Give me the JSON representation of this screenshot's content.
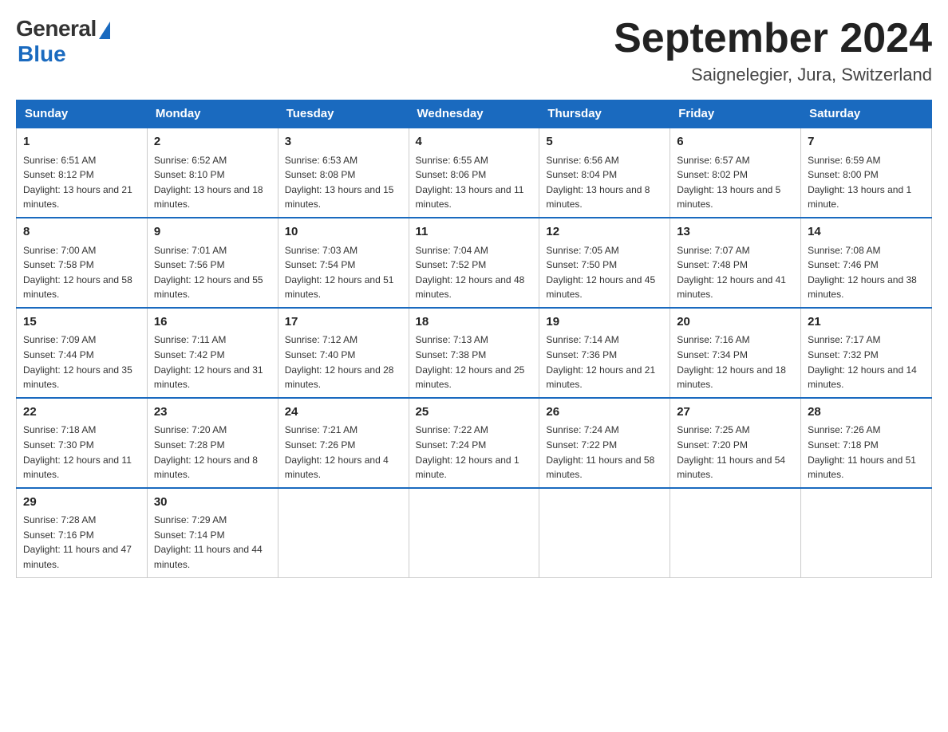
{
  "logo": {
    "general": "General",
    "blue": "Blue"
  },
  "title": "September 2024",
  "subtitle": "Saignelegier, Jura, Switzerland",
  "headers": [
    "Sunday",
    "Monday",
    "Tuesday",
    "Wednesday",
    "Thursday",
    "Friday",
    "Saturday"
  ],
  "weeks": [
    [
      {
        "day": "1",
        "sunrise": "6:51 AM",
        "sunset": "8:12 PM",
        "daylight": "13 hours and 21 minutes."
      },
      {
        "day": "2",
        "sunrise": "6:52 AM",
        "sunset": "8:10 PM",
        "daylight": "13 hours and 18 minutes."
      },
      {
        "day": "3",
        "sunrise": "6:53 AM",
        "sunset": "8:08 PM",
        "daylight": "13 hours and 15 minutes."
      },
      {
        "day": "4",
        "sunrise": "6:55 AM",
        "sunset": "8:06 PM",
        "daylight": "13 hours and 11 minutes."
      },
      {
        "day": "5",
        "sunrise": "6:56 AM",
        "sunset": "8:04 PM",
        "daylight": "13 hours and 8 minutes."
      },
      {
        "day": "6",
        "sunrise": "6:57 AM",
        "sunset": "8:02 PM",
        "daylight": "13 hours and 5 minutes."
      },
      {
        "day": "7",
        "sunrise": "6:59 AM",
        "sunset": "8:00 PM",
        "daylight": "13 hours and 1 minute."
      }
    ],
    [
      {
        "day": "8",
        "sunrise": "7:00 AM",
        "sunset": "7:58 PM",
        "daylight": "12 hours and 58 minutes."
      },
      {
        "day": "9",
        "sunrise": "7:01 AM",
        "sunset": "7:56 PM",
        "daylight": "12 hours and 55 minutes."
      },
      {
        "day": "10",
        "sunrise": "7:03 AM",
        "sunset": "7:54 PM",
        "daylight": "12 hours and 51 minutes."
      },
      {
        "day": "11",
        "sunrise": "7:04 AM",
        "sunset": "7:52 PM",
        "daylight": "12 hours and 48 minutes."
      },
      {
        "day": "12",
        "sunrise": "7:05 AM",
        "sunset": "7:50 PM",
        "daylight": "12 hours and 45 minutes."
      },
      {
        "day": "13",
        "sunrise": "7:07 AM",
        "sunset": "7:48 PM",
        "daylight": "12 hours and 41 minutes."
      },
      {
        "day": "14",
        "sunrise": "7:08 AM",
        "sunset": "7:46 PM",
        "daylight": "12 hours and 38 minutes."
      }
    ],
    [
      {
        "day": "15",
        "sunrise": "7:09 AM",
        "sunset": "7:44 PM",
        "daylight": "12 hours and 35 minutes."
      },
      {
        "day": "16",
        "sunrise": "7:11 AM",
        "sunset": "7:42 PM",
        "daylight": "12 hours and 31 minutes."
      },
      {
        "day": "17",
        "sunrise": "7:12 AM",
        "sunset": "7:40 PM",
        "daylight": "12 hours and 28 minutes."
      },
      {
        "day": "18",
        "sunrise": "7:13 AM",
        "sunset": "7:38 PM",
        "daylight": "12 hours and 25 minutes."
      },
      {
        "day": "19",
        "sunrise": "7:14 AM",
        "sunset": "7:36 PM",
        "daylight": "12 hours and 21 minutes."
      },
      {
        "day": "20",
        "sunrise": "7:16 AM",
        "sunset": "7:34 PM",
        "daylight": "12 hours and 18 minutes."
      },
      {
        "day": "21",
        "sunrise": "7:17 AM",
        "sunset": "7:32 PM",
        "daylight": "12 hours and 14 minutes."
      }
    ],
    [
      {
        "day": "22",
        "sunrise": "7:18 AM",
        "sunset": "7:30 PM",
        "daylight": "12 hours and 11 minutes."
      },
      {
        "day": "23",
        "sunrise": "7:20 AM",
        "sunset": "7:28 PM",
        "daylight": "12 hours and 8 minutes."
      },
      {
        "day": "24",
        "sunrise": "7:21 AM",
        "sunset": "7:26 PM",
        "daylight": "12 hours and 4 minutes."
      },
      {
        "day": "25",
        "sunrise": "7:22 AM",
        "sunset": "7:24 PM",
        "daylight": "12 hours and 1 minute."
      },
      {
        "day": "26",
        "sunrise": "7:24 AM",
        "sunset": "7:22 PM",
        "daylight": "11 hours and 58 minutes."
      },
      {
        "day": "27",
        "sunrise": "7:25 AM",
        "sunset": "7:20 PM",
        "daylight": "11 hours and 54 minutes."
      },
      {
        "day": "28",
        "sunrise": "7:26 AM",
        "sunset": "7:18 PM",
        "daylight": "11 hours and 51 minutes."
      }
    ],
    [
      {
        "day": "29",
        "sunrise": "7:28 AM",
        "sunset": "7:16 PM",
        "daylight": "11 hours and 47 minutes."
      },
      {
        "day": "30",
        "sunrise": "7:29 AM",
        "sunset": "7:14 PM",
        "daylight": "11 hours and 44 minutes."
      },
      null,
      null,
      null,
      null,
      null
    ]
  ]
}
